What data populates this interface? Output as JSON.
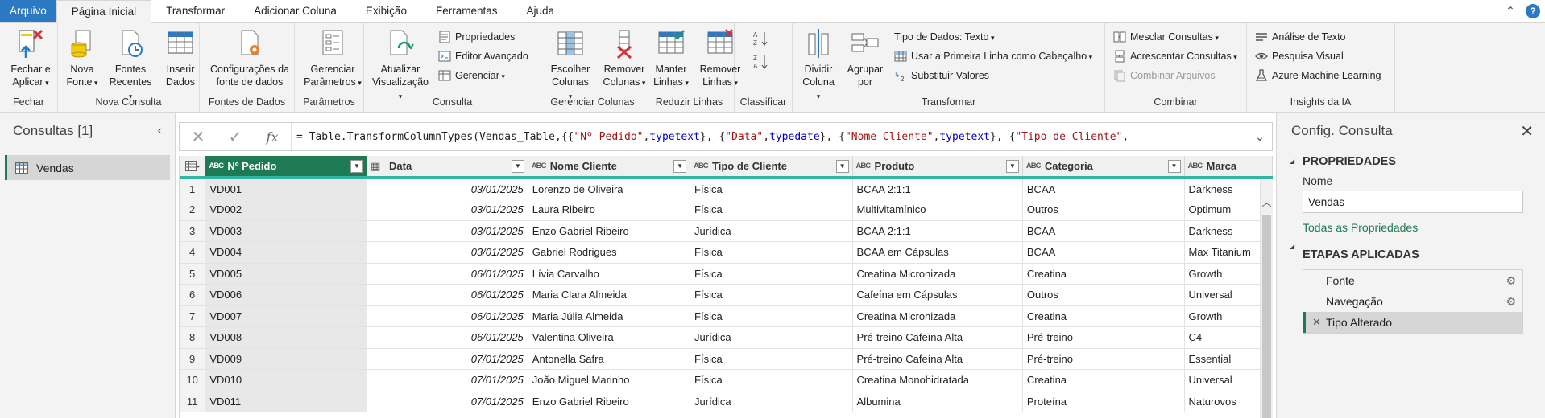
{
  "menu": {
    "tabs": [
      "Arquivo",
      "Página Inicial",
      "Transformar",
      "Adicionar Coluna",
      "Exibição",
      "Ferramentas",
      "Ajuda"
    ],
    "active_index": 1
  },
  "ribbon": {
    "fechar": {
      "label": "Fechar",
      "btn": "Fechar e Aplicar"
    },
    "nova_consulta": {
      "label": "Nova Consulta",
      "nova_fonte": "Nova Fonte",
      "fontes_recentes": "Fontes Recentes",
      "inserir_dados": "Inserir Dados"
    },
    "fontes_de_dados": {
      "label": "Fontes de Dados",
      "config": "Configurações da fonte de dados"
    },
    "parametros": {
      "label": "Parâmetros",
      "gerenciar": "Gerenciar Parâmetros"
    },
    "consulta": {
      "label": "Consulta",
      "atualizar": "Atualizar Visualização",
      "propriedades": "Propriedades",
      "editor": "Editor Avançado",
      "gerenciar": "Gerenciar"
    },
    "gerenciar_colunas": {
      "label": "Gerenciar Colunas",
      "escolher": "Escolher Colunas",
      "remover": "Remover Colunas"
    },
    "reduzir_linhas": {
      "label": "Reduzir Linhas",
      "manter": "Manter Linhas",
      "remover": "Remover Linhas"
    },
    "classificar": {
      "label": "Classificar"
    },
    "transformar": {
      "label": "Transformar",
      "dividir": "Dividir Coluna",
      "agrupar": "Agrupar por",
      "tipo_dados": "Tipo de Dados: Texto",
      "primeira_linha": "Usar a Primeira Linha como Cabeçalho",
      "substituir": "Substituir Valores"
    },
    "combinar": {
      "label": "Combinar",
      "mesclar": "Mesclar Consultas",
      "acrescentar": "Acrescentar Consultas",
      "combinar_arquivos": "Combinar Arquivos"
    },
    "insights": {
      "label": "Insights da IA",
      "texto": "Análise de Texto",
      "visual": "Pesquisa Visual",
      "ml": "Azure Machine Learning"
    }
  },
  "queries": {
    "title": "Consultas [1]",
    "items": [
      "Vendas"
    ]
  },
  "formula": {
    "text": "= Table.TransformColumnTypes(Vendas_Table,{{\"Nº Pedido\", type text}, {\"Data\", type date}, {\"Nome Cliente\", type text}, {\"Tipo de Cliente\","
  },
  "table": {
    "columns": [
      {
        "type": "ABC",
        "name": "Nº Pedido"
      },
      {
        "type": "DATE",
        "name": "Data"
      },
      {
        "type": "ABC",
        "name": "Nome Cliente"
      },
      {
        "type": "ABC",
        "name": "Tipo de Cliente"
      },
      {
        "type": "ABC",
        "name": "Produto"
      },
      {
        "type": "ABC",
        "name": "Categoria"
      },
      {
        "type": "ABC",
        "name": "Marca"
      }
    ],
    "rows": [
      [
        "VD001",
        "03/01/2025",
        "Lorenzo de Oliveira",
        "Física",
        "BCAA 2:1:1",
        "BCAA",
        "Darkness"
      ],
      [
        "VD002",
        "03/01/2025",
        "Laura Ribeiro",
        "Física",
        "Multivitamínico",
        "Outros",
        "Optimum"
      ],
      [
        "VD003",
        "03/01/2025",
        "Enzo Gabriel Ribeiro",
        "Jurídica",
        "BCAA 2:1:1",
        "BCAA",
        "Darkness"
      ],
      [
        "VD004",
        "03/01/2025",
        "Gabriel Rodrigues",
        "Física",
        "BCAA em Cápsulas",
        "BCAA",
        "Max Titanium"
      ],
      [
        "VD005",
        "06/01/2025",
        "Lívia Carvalho",
        "Física",
        "Creatina Micronizada",
        "Creatina",
        "Growth"
      ],
      [
        "VD006",
        "06/01/2025",
        "Maria Clara Almeida",
        "Física",
        "Cafeína em Cápsulas",
        "Outros",
        "Universal"
      ],
      [
        "VD007",
        "06/01/2025",
        "Maria Júlia Almeida",
        "Física",
        "Creatina Micronizada",
        "Creatina",
        "Growth"
      ],
      [
        "VD008",
        "06/01/2025",
        "Valentina Oliveira",
        "Jurídica",
        "Pré-treino Cafeína Alta",
        "Pré-treino",
        "C4"
      ],
      [
        "VD009",
        "07/01/2025",
        "Antonella Safra",
        "Física",
        "Pré-treino Cafeína Alta",
        "Pré-treino",
        "Essential"
      ],
      [
        "VD010",
        "07/01/2025",
        "João Miguel Marinho",
        "Física",
        "Creatina Monohidratada",
        "Creatina",
        "Universal"
      ],
      [
        "VD011",
        "07/01/2025",
        "Enzo Gabriel Ribeiro",
        "Jurídica",
        "Albumina",
        "Proteína",
        "Naturovos"
      ]
    ]
  },
  "settings": {
    "title": "Config. Consulta",
    "properties": "PROPRIEDADES",
    "name_label": "Nome",
    "name_value": "Vendas",
    "all_props": "Todas as Propriedades",
    "steps_title": "ETAPAS APLICADAS",
    "steps": [
      "Fonte",
      "Navegação",
      "Tipo Alterado"
    ]
  },
  "colors": {
    "accent": "#1e7a53",
    "teal": "#2fb7a1",
    "file_tab": "#2b79c2"
  }
}
